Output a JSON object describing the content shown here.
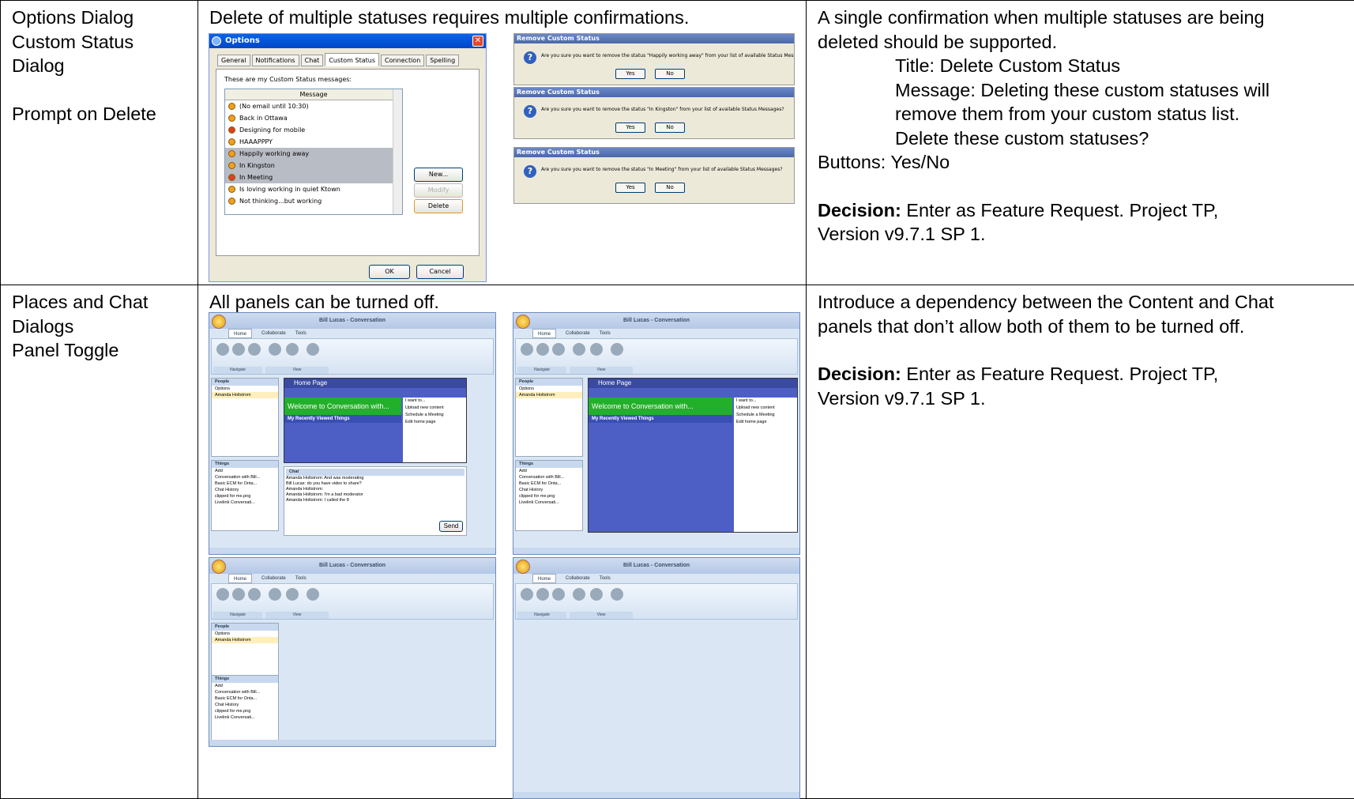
{
  "row1": {
    "col1": [
      "Options Dialog",
      "Custom Status",
      "Dialog",
      "",
      "Prompt on Delete"
    ],
    "col2_text": "Delete of multiple statuses requires multiple confirmations.",
    "col3": {
      "line1": "A single confirmation when multiple statuses are being",
      "line2": "deleted should be supported.",
      "title_line": "Title: Delete Custom Status",
      "msg1": "Message: Deleting these custom statuses will",
      "msg2": "remove them from your custom status list.",
      "msg3": "Delete these custom statuses?",
      "buttons": "Buttons: Yes/No",
      "decision_label": "Decision:",
      "decision1": " Enter as Feature Request. Project TP,",
      "decision2": "Version v9.7.1 SP 1."
    }
  },
  "row2": {
    "col1": [
      "Places and Chat",
      "Dialogs",
      "Panel Toggle"
    ],
    "col2_text": "All panels can be turned off.",
    "col3": {
      "line1": "Introduce a dependency between the Content and Chat",
      "line2": "panels that don’t allow both of them to be turned off.",
      "decision_label": "Decision:",
      "decision1": " Enter as Feature Request. Project TP,",
      "decision2": "Version v9.7.1 SP 1."
    }
  },
  "options_dialog": {
    "title": "Options",
    "tabs": [
      "General",
      "Notifications",
      "Chat",
      "Custom Status",
      "Connection",
      "Spelling"
    ],
    "label": "These are my Custom Status messages:",
    "column": "Message",
    "items": [
      {
        "text": "(No email until 10:30)",
        "sel": false,
        "red": false
      },
      {
        "text": "Back in Ottawa",
        "sel": false,
        "red": false
      },
      {
        "text": "Designing for mobile",
        "sel": false,
        "red": true
      },
      {
        "text": "HAAAPPPY",
        "sel": false,
        "red": false
      },
      {
        "text": "Happily working away",
        "sel": true,
        "red": false
      },
      {
        "text": "In Kingston",
        "sel": true,
        "red": false
      },
      {
        "text": "In Meeting",
        "sel": true,
        "red": true
      },
      {
        "text": "Is loving working in quiet Ktown",
        "sel": false,
        "red": false
      },
      {
        "text": "Not thinking...but working",
        "sel": false,
        "red": false
      }
    ],
    "btn_new": "New...",
    "btn_modify": "Modify",
    "btn_delete": "Delete",
    "btn_ok": "OK",
    "btn_cancel": "Cancel"
  },
  "confirms": [
    {
      "title": "Remove Custom Status",
      "msg": "Are you sure you want to remove the status \"Happily working away\" from your list of available Status Messages?"
    },
    {
      "title": "Remove Custom Status",
      "msg": "Are you sure you want to remove the status \"In Kingston\" from your list of available Status Messages?"
    },
    {
      "title": "Remove Custom Status",
      "msg": "Are you sure you want to remove the status \"In Meeting\" from your list of available Status Messages?"
    }
  ],
  "confirm_yes": "Yes",
  "confirm_no": "No",
  "app": {
    "title": "Bill Lucas - Conversation",
    "tabs": [
      "Home",
      "Collaborate",
      "Tools"
    ],
    "groups": [
      "Navigate",
      "View"
    ],
    "people": "People",
    "options": "Options",
    "person": "Amanda Holtstrom",
    "things": "Things",
    "add": "Add",
    "thing_items": [
      "Conversation with Bill...",
      "Basic ECM for Onta...",
      "Chat History",
      "clipped for me.png",
      "Livelink Conversati..."
    ],
    "home_page": "Home Page",
    "welcome": "Welcome to Conversation with...",
    "recent": "My Recently Viewed Things",
    "iwant": "I want to...",
    "iwant_items": [
      "Upload new content",
      "Schedule a Meeting",
      "Edit home page"
    ],
    "chat": "Chat",
    "chat_lines": [
      "Amanda Holtstrom: And was moderating",
      "Bill Lucas: do you have video to share?",
      "Amanda Holtstrom:",
      "Amanda Holtstrom: I'm a bad moderator",
      "Amanda Holtstrom: I called the 8"
    ],
    "send": "Send"
  }
}
